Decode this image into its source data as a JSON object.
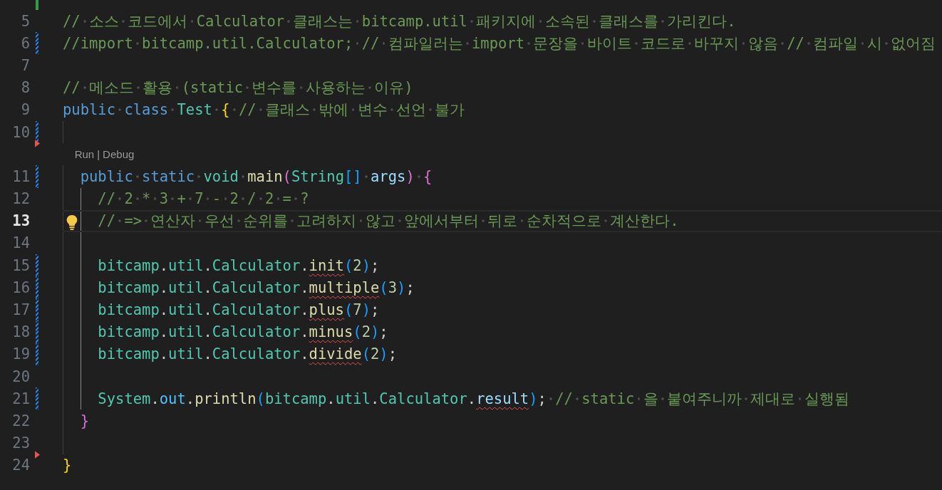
{
  "editor": {
    "render_whitespace": true,
    "lines": [
      {
        "added": true
      },
      {
        "number": "5",
        "tokens": [
          {
            "kind": "comment",
            "t": "// 소스 코드에서 Calculator 클래스는 bitcamp.util 패키지에 소속된 클래스를 가리킨다."
          }
        ]
      },
      {
        "number": "6",
        "modified": true,
        "tokens": [
          {
            "kind": "comment",
            "t": "//import bitcamp.util.Calculator; // 컴파일러는 import 문장을 바이트 코드로 바꾸지 않음 // 컴파일 시 없어짐"
          }
        ]
      },
      {
        "number": "7"
      },
      {
        "number": "8",
        "tokens": [
          {
            "kind": "comment",
            "t": "// 메소드 활용 (static 변수를 사용하는 이유)"
          }
        ]
      },
      {
        "number": "9",
        "tokens": [
          {
            "kind": "keyword",
            "t": "public class"
          },
          {
            "kind": "type",
            "t": " Test"
          },
          {
            "kind": "brace1",
            "t": " {"
          },
          {
            "kind": "comment",
            "t": " // 클래스 밖에 변수 선언 불가"
          }
        ]
      },
      {
        "number": "10",
        "modified": true,
        "deleted_after": true,
        "guides": [
          false
        ]
      },
      {
        "number": "11",
        "modified": true,
        "codelens": {
          "items": [
            "Run",
            "Debug"
          ],
          "separator": "|"
        },
        "guides": [
          false
        ],
        "tokens": [
          {
            "kind": "keyword",
            "t": "public static"
          },
          {
            "kind": "type",
            "t": " void"
          },
          {
            "kind": "func",
            "t": " main"
          },
          {
            "kind": "brace2",
            "t": "("
          },
          {
            "kind": "type",
            "t": "String"
          },
          {
            "kind": "brace3",
            "t": "[]"
          },
          {
            "kind": "var",
            "t": " args"
          },
          {
            "kind": "brace2",
            "t": ") {"
          }
        ]
      },
      {
        "number": "12",
        "guides": [
          false,
          true
        ],
        "tokens": [
          {
            "kind": "comment",
            "t": "// 2 * 3 + 7 - 2 / 2 = ?"
          }
        ]
      },
      {
        "number": "13",
        "current": true,
        "lightbulb": true,
        "guides": [
          false,
          true
        ],
        "tokens": [
          {
            "kind": "comment",
            "t": "// => 연산자 우선 순위를 고려하지 않고 앞에서부터 뒤로 순차적으로 계산한다."
          }
        ]
      },
      {
        "number": "14",
        "guides": [
          false,
          true
        ]
      },
      {
        "number": "15",
        "modified": true,
        "guides": [
          false,
          true
        ],
        "tokens": [
          {
            "kind": "type",
            "t": "bitcamp"
          },
          {
            "kind": "punct",
            "t": "."
          },
          {
            "kind": "type",
            "t": "util"
          },
          {
            "kind": "punct",
            "t": "."
          },
          {
            "kind": "type",
            "t": "Calculator"
          },
          {
            "kind": "punct",
            "t": "."
          },
          {
            "kind": "func",
            "t": "init",
            "error": true
          },
          {
            "kind": "brace3",
            "t": "("
          },
          {
            "kind": "num",
            "t": "2"
          },
          {
            "kind": "brace3",
            "t": ")"
          },
          {
            "kind": "punct",
            "t": ";"
          }
        ]
      },
      {
        "number": "16",
        "modified": true,
        "guides": [
          false,
          true
        ],
        "tokens": [
          {
            "kind": "type",
            "t": "bitcamp"
          },
          {
            "kind": "punct",
            "t": "."
          },
          {
            "kind": "type",
            "t": "util"
          },
          {
            "kind": "punct",
            "t": "."
          },
          {
            "kind": "type",
            "t": "Calculator"
          },
          {
            "kind": "punct",
            "t": "."
          },
          {
            "kind": "func",
            "t": "multiple",
            "error": true
          },
          {
            "kind": "brace3",
            "t": "("
          },
          {
            "kind": "num",
            "t": "3"
          },
          {
            "kind": "brace3",
            "t": ")"
          },
          {
            "kind": "punct",
            "t": ";"
          }
        ]
      },
      {
        "number": "17",
        "modified": true,
        "guides": [
          false,
          true
        ],
        "tokens": [
          {
            "kind": "type",
            "t": "bitcamp"
          },
          {
            "kind": "punct",
            "t": "."
          },
          {
            "kind": "type",
            "t": "util"
          },
          {
            "kind": "punct",
            "t": "."
          },
          {
            "kind": "type",
            "t": "Calculator"
          },
          {
            "kind": "punct",
            "t": "."
          },
          {
            "kind": "func",
            "t": "plus",
            "error": true
          },
          {
            "kind": "brace3",
            "t": "("
          },
          {
            "kind": "num",
            "t": "7"
          },
          {
            "kind": "brace3",
            "t": ")"
          },
          {
            "kind": "punct",
            "t": ";"
          }
        ]
      },
      {
        "number": "18",
        "modified": true,
        "guides": [
          false,
          true
        ],
        "tokens": [
          {
            "kind": "type",
            "t": "bitcamp"
          },
          {
            "kind": "punct",
            "t": "."
          },
          {
            "kind": "type",
            "t": "util"
          },
          {
            "kind": "punct",
            "t": "."
          },
          {
            "kind": "type",
            "t": "Calculator"
          },
          {
            "kind": "punct",
            "t": "."
          },
          {
            "kind": "func",
            "t": "minus",
            "error": true
          },
          {
            "kind": "brace3",
            "t": "("
          },
          {
            "kind": "num",
            "t": "2"
          },
          {
            "kind": "brace3",
            "t": ")"
          },
          {
            "kind": "punct",
            "t": ";"
          }
        ]
      },
      {
        "number": "19",
        "modified": true,
        "guides": [
          false,
          true
        ],
        "tokens": [
          {
            "kind": "type",
            "t": "bitcamp"
          },
          {
            "kind": "punct",
            "t": "."
          },
          {
            "kind": "type",
            "t": "util"
          },
          {
            "kind": "punct",
            "t": "."
          },
          {
            "kind": "type",
            "t": "Calculator"
          },
          {
            "kind": "punct",
            "t": "."
          },
          {
            "kind": "func",
            "t": "divide",
            "error": true
          },
          {
            "kind": "brace3",
            "t": "("
          },
          {
            "kind": "num",
            "t": "2"
          },
          {
            "kind": "brace3",
            "t": ")"
          },
          {
            "kind": "punct",
            "t": ";"
          }
        ]
      },
      {
        "number": "20",
        "guides": [
          false,
          true
        ]
      },
      {
        "number": "21",
        "modified": true,
        "guides": [
          false,
          true
        ],
        "tokens": [
          {
            "kind": "type",
            "t": "System"
          },
          {
            "kind": "punct",
            "t": "."
          },
          {
            "kind": "field",
            "t": "out"
          },
          {
            "kind": "punct",
            "t": "."
          },
          {
            "kind": "func",
            "t": "println"
          },
          {
            "kind": "brace3",
            "t": "("
          },
          {
            "kind": "type",
            "t": "bitcamp"
          },
          {
            "kind": "punct",
            "t": "."
          },
          {
            "kind": "type",
            "t": "util"
          },
          {
            "kind": "punct",
            "t": "."
          },
          {
            "kind": "type",
            "t": "Calculator"
          },
          {
            "kind": "punct",
            "t": "."
          },
          {
            "kind": "var",
            "t": "result",
            "error": true
          },
          {
            "kind": "brace3",
            "t": ")"
          },
          {
            "kind": "punct",
            "t": ";"
          },
          {
            "kind": "comment",
            "t": " // static 을 붙여주니까 제대로 실행됨"
          }
        ]
      },
      {
        "number": "22",
        "guides": [
          false
        ],
        "tokens": [
          {
            "kind": "brace2",
            "t": "}"
          }
        ]
      },
      {
        "number": "23",
        "deleted_after": true,
        "guides": [
          false
        ]
      },
      {
        "number": "24",
        "tokens": [
          {
            "kind": "brace1",
            "t": "}"
          }
        ]
      }
    ]
  }
}
